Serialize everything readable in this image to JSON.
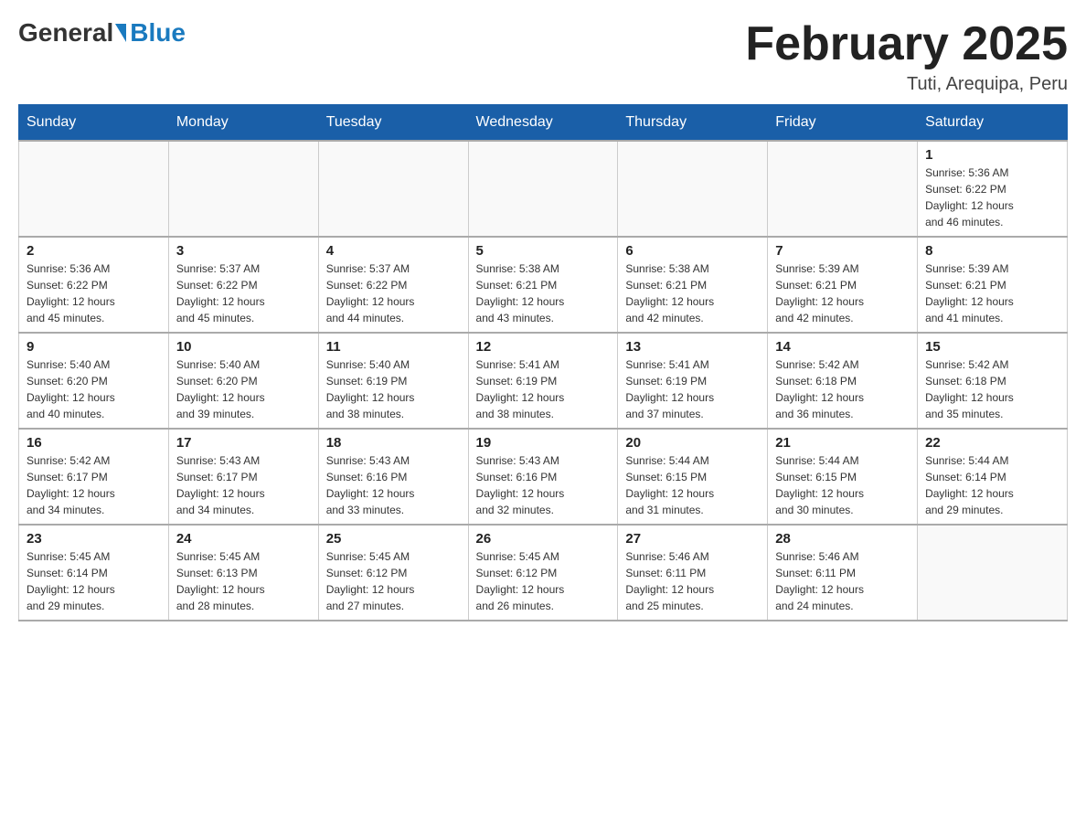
{
  "header": {
    "logo_general": "General",
    "logo_blue": "Blue",
    "month_title": "February 2025",
    "location": "Tuti, Arequipa, Peru"
  },
  "weekdays": [
    "Sunday",
    "Monday",
    "Tuesday",
    "Wednesday",
    "Thursday",
    "Friday",
    "Saturday"
  ],
  "weeks": [
    [
      {
        "day": "",
        "info": ""
      },
      {
        "day": "",
        "info": ""
      },
      {
        "day": "",
        "info": ""
      },
      {
        "day": "",
        "info": ""
      },
      {
        "day": "",
        "info": ""
      },
      {
        "day": "",
        "info": ""
      },
      {
        "day": "1",
        "info": "Sunrise: 5:36 AM\nSunset: 6:22 PM\nDaylight: 12 hours\nand 46 minutes."
      }
    ],
    [
      {
        "day": "2",
        "info": "Sunrise: 5:36 AM\nSunset: 6:22 PM\nDaylight: 12 hours\nand 45 minutes."
      },
      {
        "day": "3",
        "info": "Sunrise: 5:37 AM\nSunset: 6:22 PM\nDaylight: 12 hours\nand 45 minutes."
      },
      {
        "day": "4",
        "info": "Sunrise: 5:37 AM\nSunset: 6:22 PM\nDaylight: 12 hours\nand 44 minutes."
      },
      {
        "day": "5",
        "info": "Sunrise: 5:38 AM\nSunset: 6:21 PM\nDaylight: 12 hours\nand 43 minutes."
      },
      {
        "day": "6",
        "info": "Sunrise: 5:38 AM\nSunset: 6:21 PM\nDaylight: 12 hours\nand 42 minutes."
      },
      {
        "day": "7",
        "info": "Sunrise: 5:39 AM\nSunset: 6:21 PM\nDaylight: 12 hours\nand 42 minutes."
      },
      {
        "day": "8",
        "info": "Sunrise: 5:39 AM\nSunset: 6:21 PM\nDaylight: 12 hours\nand 41 minutes."
      }
    ],
    [
      {
        "day": "9",
        "info": "Sunrise: 5:40 AM\nSunset: 6:20 PM\nDaylight: 12 hours\nand 40 minutes."
      },
      {
        "day": "10",
        "info": "Sunrise: 5:40 AM\nSunset: 6:20 PM\nDaylight: 12 hours\nand 39 minutes."
      },
      {
        "day": "11",
        "info": "Sunrise: 5:40 AM\nSunset: 6:19 PM\nDaylight: 12 hours\nand 38 minutes."
      },
      {
        "day": "12",
        "info": "Sunrise: 5:41 AM\nSunset: 6:19 PM\nDaylight: 12 hours\nand 38 minutes."
      },
      {
        "day": "13",
        "info": "Sunrise: 5:41 AM\nSunset: 6:19 PM\nDaylight: 12 hours\nand 37 minutes."
      },
      {
        "day": "14",
        "info": "Sunrise: 5:42 AM\nSunset: 6:18 PM\nDaylight: 12 hours\nand 36 minutes."
      },
      {
        "day": "15",
        "info": "Sunrise: 5:42 AM\nSunset: 6:18 PM\nDaylight: 12 hours\nand 35 minutes."
      }
    ],
    [
      {
        "day": "16",
        "info": "Sunrise: 5:42 AM\nSunset: 6:17 PM\nDaylight: 12 hours\nand 34 minutes."
      },
      {
        "day": "17",
        "info": "Sunrise: 5:43 AM\nSunset: 6:17 PM\nDaylight: 12 hours\nand 34 minutes."
      },
      {
        "day": "18",
        "info": "Sunrise: 5:43 AM\nSunset: 6:16 PM\nDaylight: 12 hours\nand 33 minutes."
      },
      {
        "day": "19",
        "info": "Sunrise: 5:43 AM\nSunset: 6:16 PM\nDaylight: 12 hours\nand 32 minutes."
      },
      {
        "day": "20",
        "info": "Sunrise: 5:44 AM\nSunset: 6:15 PM\nDaylight: 12 hours\nand 31 minutes."
      },
      {
        "day": "21",
        "info": "Sunrise: 5:44 AM\nSunset: 6:15 PM\nDaylight: 12 hours\nand 30 minutes."
      },
      {
        "day": "22",
        "info": "Sunrise: 5:44 AM\nSunset: 6:14 PM\nDaylight: 12 hours\nand 29 minutes."
      }
    ],
    [
      {
        "day": "23",
        "info": "Sunrise: 5:45 AM\nSunset: 6:14 PM\nDaylight: 12 hours\nand 29 minutes."
      },
      {
        "day": "24",
        "info": "Sunrise: 5:45 AM\nSunset: 6:13 PM\nDaylight: 12 hours\nand 28 minutes."
      },
      {
        "day": "25",
        "info": "Sunrise: 5:45 AM\nSunset: 6:12 PM\nDaylight: 12 hours\nand 27 minutes."
      },
      {
        "day": "26",
        "info": "Sunrise: 5:45 AM\nSunset: 6:12 PM\nDaylight: 12 hours\nand 26 minutes."
      },
      {
        "day": "27",
        "info": "Sunrise: 5:46 AM\nSunset: 6:11 PM\nDaylight: 12 hours\nand 25 minutes."
      },
      {
        "day": "28",
        "info": "Sunrise: 5:46 AM\nSunset: 6:11 PM\nDaylight: 12 hours\nand 24 minutes."
      },
      {
        "day": "",
        "info": ""
      }
    ]
  ]
}
